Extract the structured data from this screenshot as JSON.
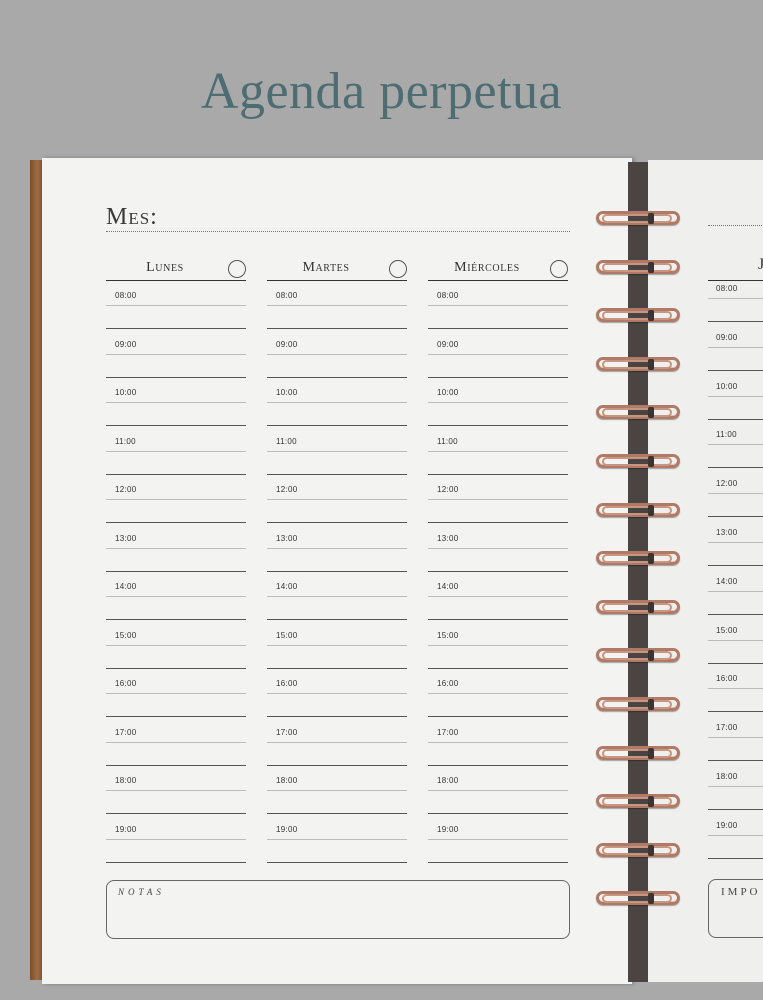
{
  "title": "Agenda perpetua",
  "month_label": "Mes:",
  "days": [
    {
      "name": "Lunes"
    },
    {
      "name": "Martes"
    },
    {
      "name": "Miércoles"
    }
  ],
  "hours": [
    "08:00",
    "09:00",
    "10:00",
    "11:00",
    "12:00",
    "13:00",
    "14:00",
    "15:00",
    "16:00",
    "17:00",
    "18:00",
    "19:00"
  ],
  "notes_label": "NOTAS",
  "right_page": {
    "day_initial": "J",
    "hours": [
      "08:00",
      "09:00",
      "10:00",
      "11:00",
      "12:00",
      "13:00",
      "14:00",
      "15:00",
      "16:00",
      "17:00",
      "18:00",
      "19:00"
    ],
    "box_label": "IMPO"
  },
  "colors": {
    "title": "#4d6d72",
    "background": "#a9a9a9",
    "page": "#f3f3f1",
    "rings": "#b07a67"
  }
}
